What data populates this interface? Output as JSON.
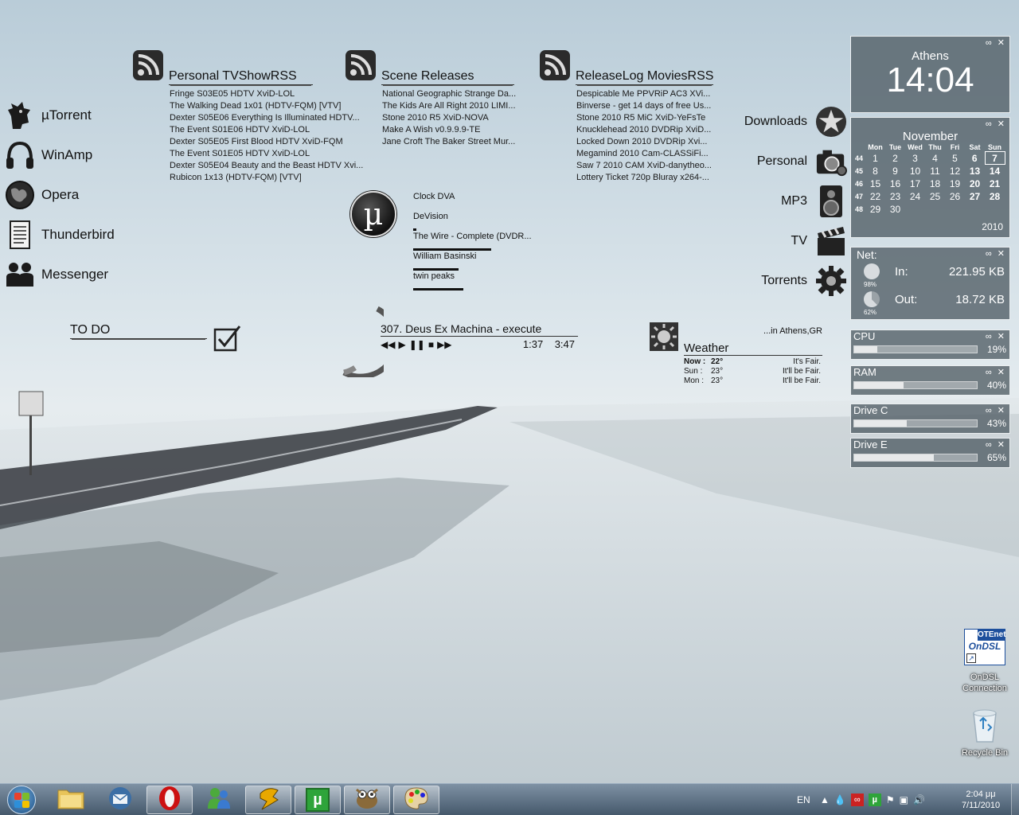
{
  "left_launcher": [
    {
      "label": "µTorrent",
      "icon": "utorrent-lion-icon"
    },
    {
      "label": "WinAmp",
      "icon": "headphones-icon"
    },
    {
      "label": "Opera",
      "icon": "globe-icon"
    },
    {
      "label": "Thunderbird",
      "icon": "document-icon"
    },
    {
      "label": "Messenger",
      "icon": "people-icon"
    }
  ],
  "rss_feeds": [
    {
      "title": "Personal TVShowRSS",
      "items": [
        "Fringe S03E05 HDTV XviD-LOL",
        "The Walking Dead 1x01 (HDTV-FQM) [VTV]",
        "Dexter S05E06 Everything Is Illuminated HDTV...",
        "The Event S01E06 HDTV XviD-LOL",
        "Dexter S05E05 First Blood HDTV XviD-FQM",
        "The Event S01E05 HDTV XviD-LOL",
        "Dexter S05E04 Beauty and the Beast HDTV Xvi...",
        "Rubicon 1x13 (HDTV-FQM) [VTV]"
      ]
    },
    {
      "title": "Scene Releases",
      "items": [
        "National Geographic Strange Da...",
        "The Kids Are All Right 2010 LIMI...",
        "Stone 2010 R5 XviD-NOVA",
        "Make A Wish v0.9.9.9-TE",
        "Jane Croft The Baker Street Mur..."
      ]
    },
    {
      "title": "ReleaseLog MoviesRSS",
      "items": [
        "Despicable Me PPVRiP AC3 XVi...",
        "Binverse - get 14 days of free Us...",
        "Stone 2010 R5 MiC XviD-YeFsTe",
        "Knucklehead 2010 DVDRip XviD...",
        "Locked Down 2010 DVDRip Xvi...",
        "Megamind 2010 Cam-CLASSiFi...",
        "Saw 7 2010 CAM XviD-danytheo...",
        "Lottery Ticket 720p Bluray x264-..."
      ]
    }
  ],
  "utorrent_widget": {
    "items": [
      "Clock DVA",
      "DeVision",
      "The Wire - Complete (DVDR...",
      "William Basinski",
      "twin peaks"
    ],
    "progress": [
      0,
      0,
      0.04,
      1,
      0.58,
      0.64
    ]
  },
  "todo": {
    "label": "TO DO"
  },
  "winamp": {
    "track": "307. Deus Ex Machina - execute",
    "elapsed": "1:37",
    "total": "3:47",
    "controls": [
      "prev",
      "play",
      "pause",
      "stop",
      "next"
    ]
  },
  "weather": {
    "title": "Weather",
    "location": "...in Athens,GR",
    "rows": [
      {
        "day": "Now :",
        "temp": "22°",
        "cond": "It's Fair."
      },
      {
        "day": "Sun :",
        "temp": "23°",
        "cond": "It'll be Fair."
      },
      {
        "day": "Mon :",
        "temp": "23°",
        "cond": "It'll be Fair."
      }
    ]
  },
  "right_launcher": [
    {
      "label": "Downloads",
      "icon": "star-icon"
    },
    {
      "label": "Personal",
      "icon": "camera-icon"
    },
    {
      "label": "MP3",
      "icon": "speaker-icon"
    },
    {
      "label": "TV",
      "icon": "clapperboard-icon"
    },
    {
      "label": "Torrents",
      "icon": "gear-icon"
    }
  ],
  "clock": {
    "city": "Athens",
    "time": "14:04"
  },
  "calendar": {
    "month": "November",
    "year": "2010",
    "days_header": [
      "Mon",
      "Tue",
      "Wed",
      "Thu",
      "Fri",
      "Sat",
      "Sun"
    ],
    "weeks": [
      {
        "wk": "44",
        "days": [
          "1",
          "2",
          "3",
          "4",
          "5",
          "6",
          "7"
        ]
      },
      {
        "wk": "45",
        "days": [
          "8",
          "9",
          "10",
          "11",
          "12",
          "13",
          "14"
        ]
      },
      {
        "wk": "46",
        "days": [
          "15",
          "16",
          "17",
          "18",
          "19",
          "20",
          "21"
        ]
      },
      {
        "wk": "47",
        "days": [
          "22",
          "23",
          "24",
          "25",
          "26",
          "27",
          "28"
        ]
      },
      {
        "wk": "48",
        "days": [
          "29",
          "30",
          "",
          "",
          "",
          "",
          ""
        ]
      }
    ],
    "today": "7"
  },
  "net": {
    "title": "Net:",
    "in_label": "In:",
    "in_value": "221.95 KB",
    "out_label": "Out:",
    "out_value": "18.72 KB",
    "in_pct": "98%",
    "out_pct": "62%",
    "in_fraction": 0.98,
    "out_fraction": 0.62
  },
  "meters": [
    {
      "label": "CPU",
      "value": "19%",
      "fraction": 0.19
    },
    {
      "label": "RAM",
      "value": "40%",
      "fraction": 0.4
    },
    {
      "label": "Drive C",
      "value": "43%",
      "fraction": 0.43
    },
    {
      "label": "Drive E",
      "value": "65%",
      "fraction": 0.65
    }
  ],
  "desktop_icons": [
    {
      "label": "OnDSL Connection",
      "logo_lines": [
        "OTEnet",
        "OnDSL"
      ]
    },
    {
      "label": "Recycle Bin"
    }
  ],
  "taskbar": {
    "apps": [
      "start",
      "explorer",
      "thunderbird",
      "opera",
      "messenger",
      "winamp",
      "utorrent",
      "gimp",
      "paint"
    ],
    "tray": {
      "lang": "EN",
      "time": "2:04 μμ",
      "date": "7/11/2010"
    }
  },
  "colors": {
    "gadget_bg": "#505c64",
    "accent_green": "#2ea43a",
    "opera_red": "#cc1111"
  }
}
